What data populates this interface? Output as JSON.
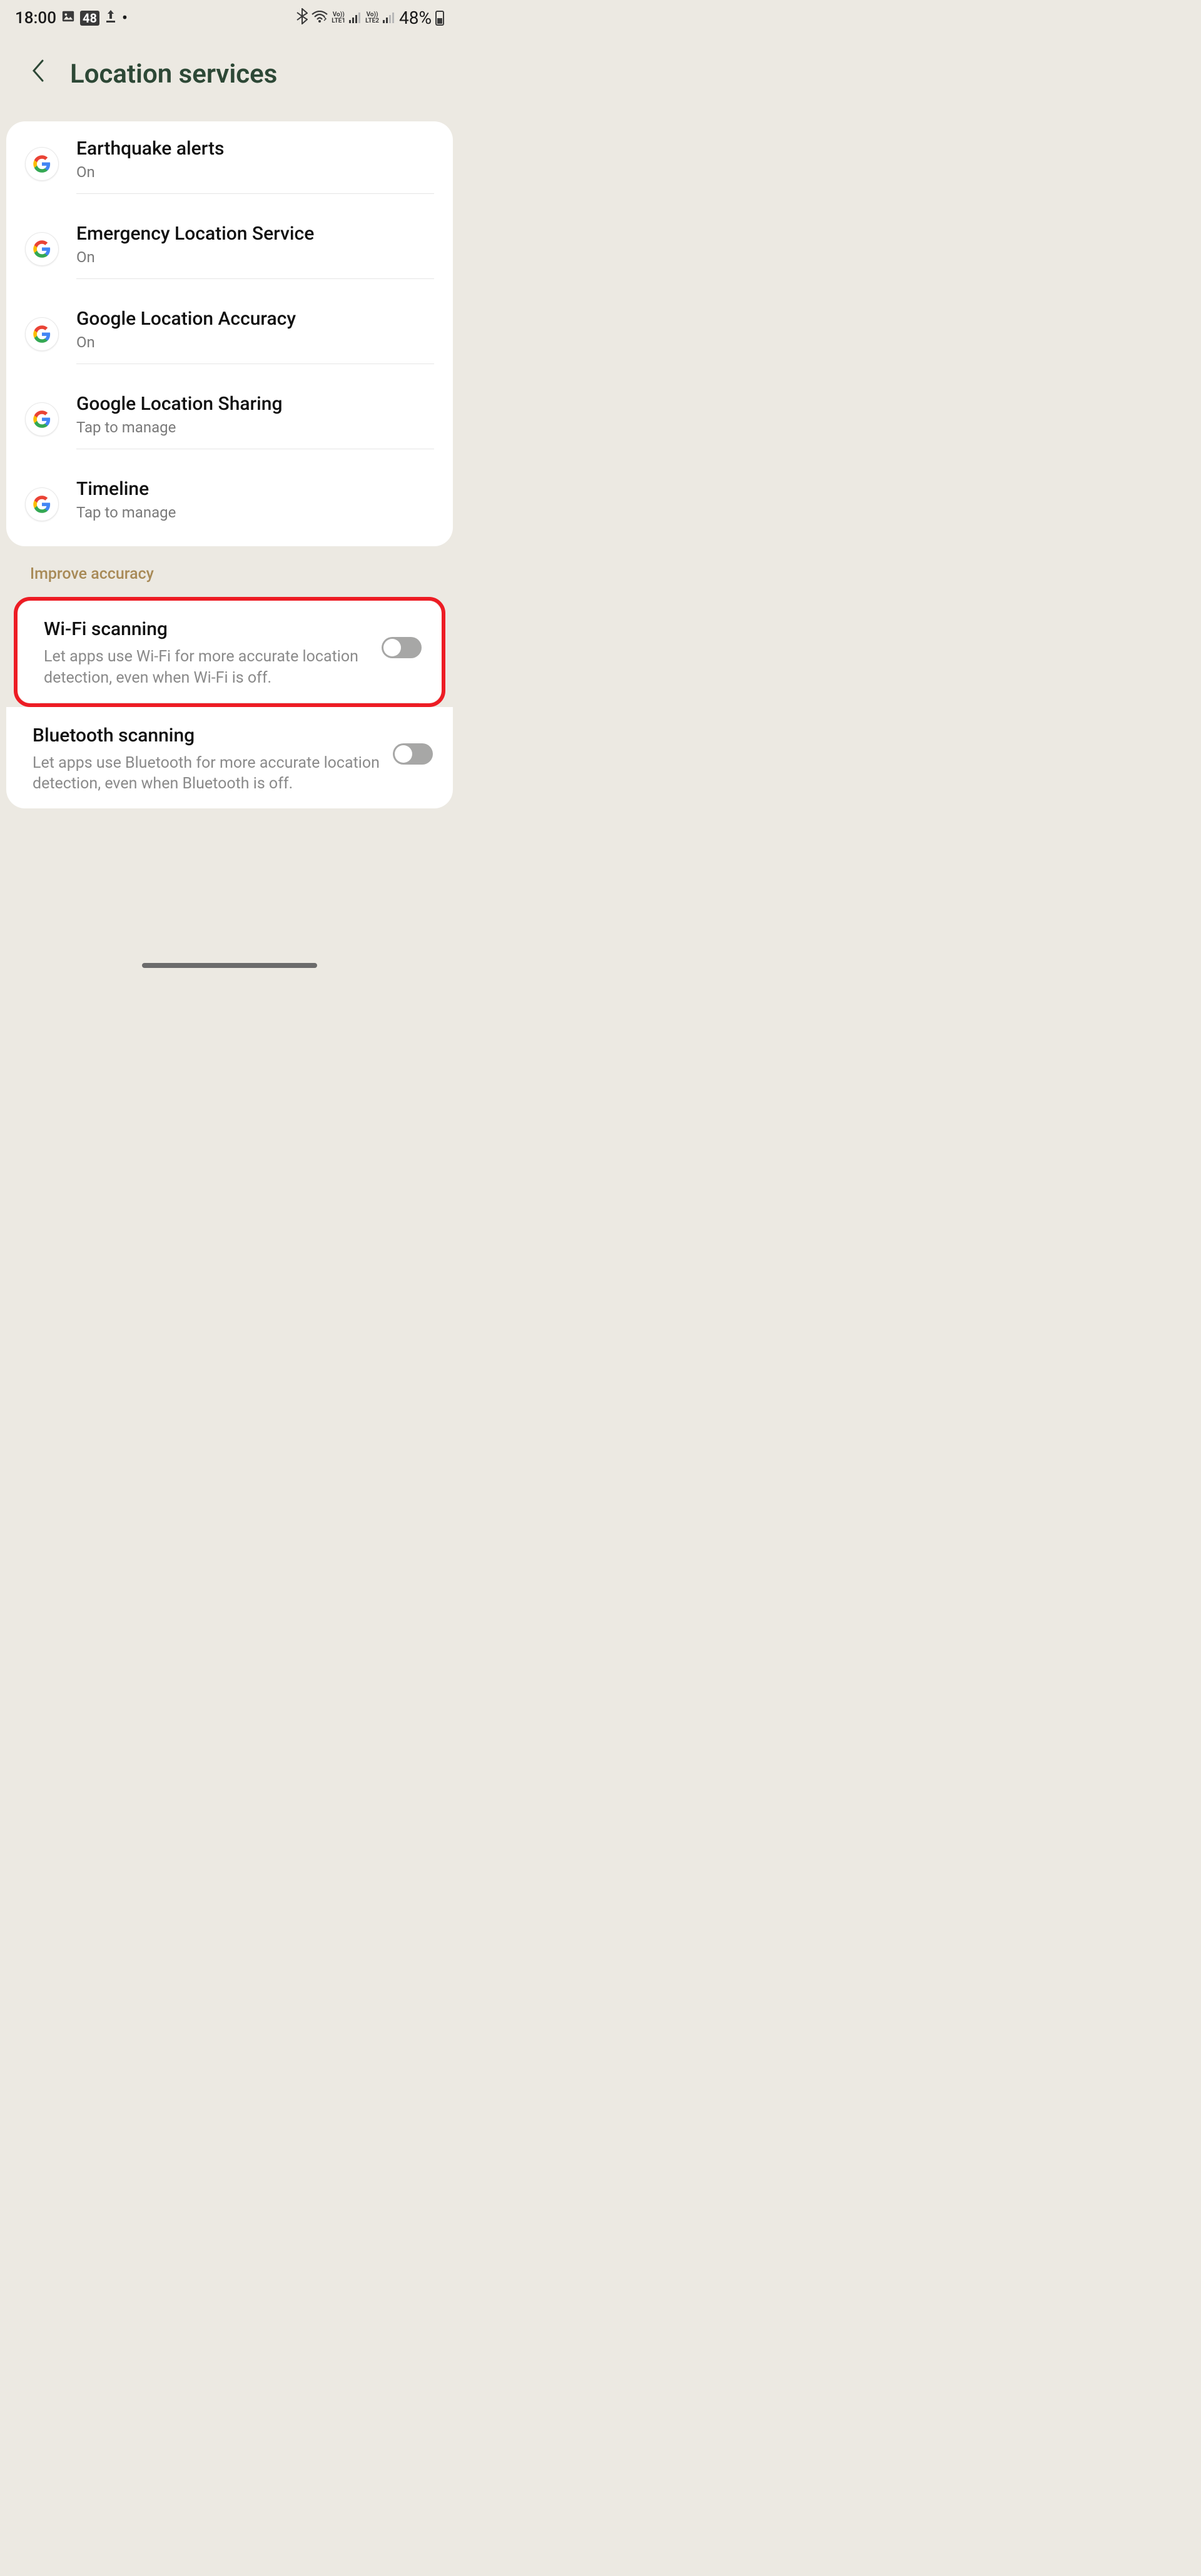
{
  "status": {
    "time": "18:00",
    "notif_count": "48",
    "battery_pct": "48%",
    "lte1": "LTE1",
    "lte2": "LTE2",
    "vo": "Vo))"
  },
  "header": {
    "title": "Location services"
  },
  "google_rows": [
    {
      "title": "Earthquake alerts",
      "sub": "On"
    },
    {
      "title": "Emergency Location Service",
      "sub": "On"
    },
    {
      "title": "Google Location Accuracy",
      "sub": "On"
    },
    {
      "title": "Google Location Sharing",
      "sub": "Tap to manage"
    },
    {
      "title": "Timeline",
      "sub": "Tap to manage"
    }
  ],
  "section_label": "Improve accuracy",
  "wifi_scan": {
    "title": "Wi-Fi scanning",
    "desc": "Let apps use Wi-Fi for more accurate location detection, even when Wi-Fi is off."
  },
  "bt_scan": {
    "title": "Bluetooth scanning",
    "desc": "Let apps use Bluetooth for more accurate location detection, even when Bluetooth is off."
  }
}
